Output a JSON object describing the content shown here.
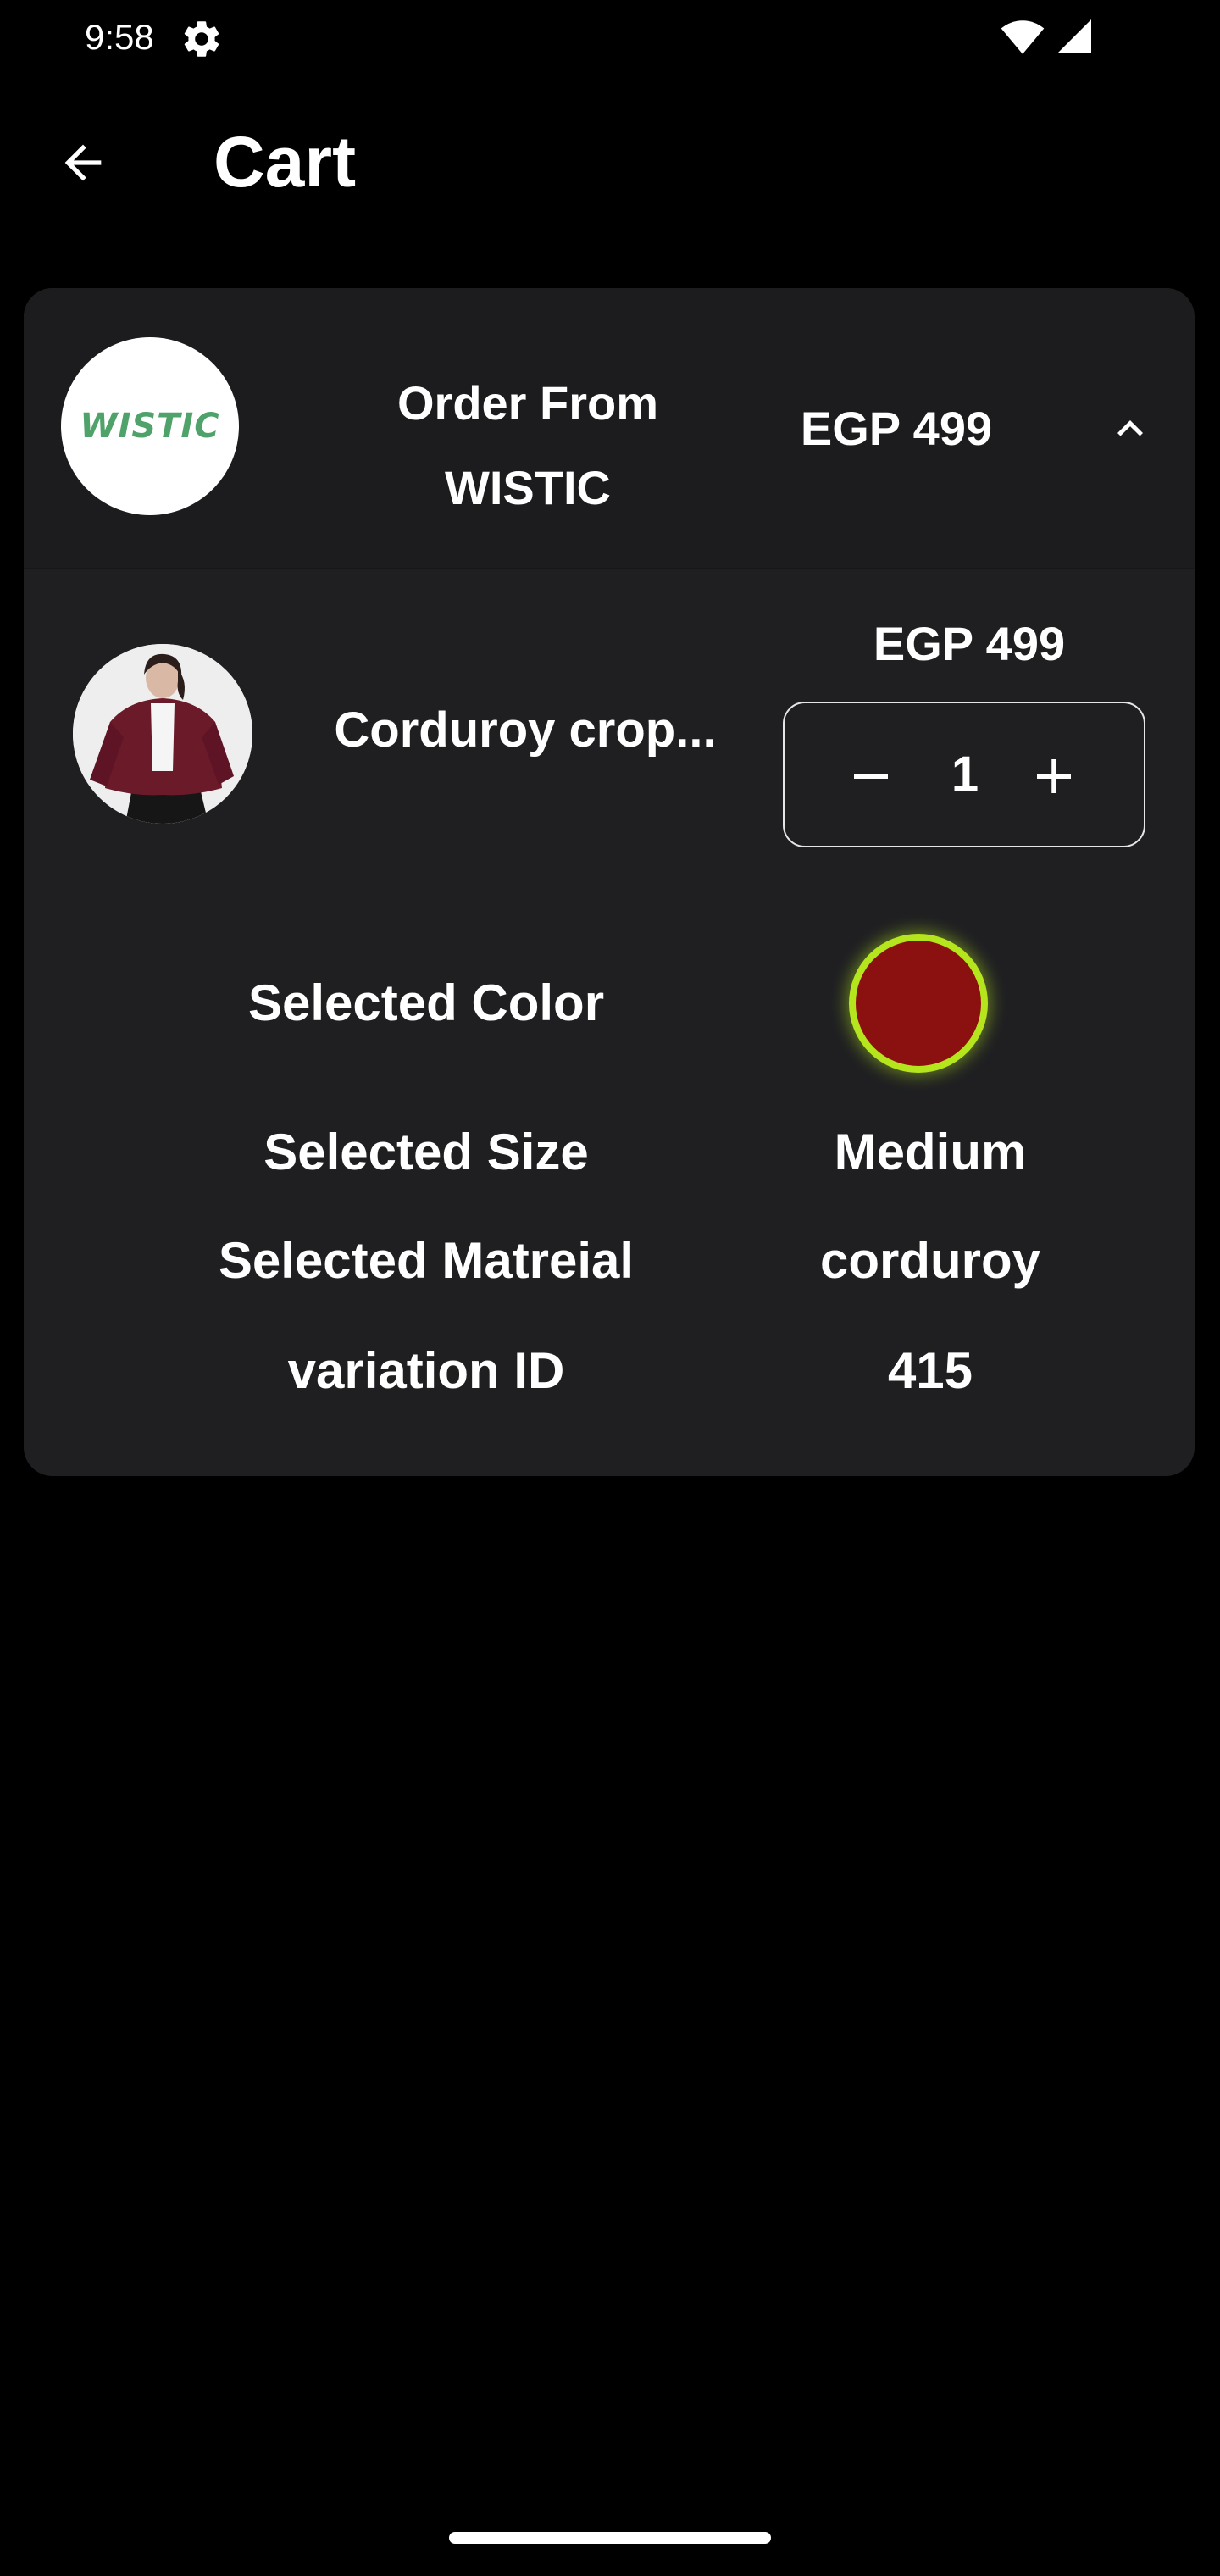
{
  "status_bar": {
    "time": "9:58",
    "icons": [
      "settings-gear-icon",
      "wifi-icon",
      "cellular-signal-icon"
    ]
  },
  "app_bar": {
    "back_icon": "arrow-back-icon",
    "title": "Cart"
  },
  "order": {
    "store_logo_text": "WISTIC",
    "title_line1": "Order From",
    "title_line2": "WISTIC",
    "total": "EGP 499",
    "toggle_icon": "chevron-up-icon",
    "item": {
      "name": "Corduroy crop...",
      "price": "EGP 499",
      "quantity": "1",
      "minus_icon": "minus-icon",
      "plus_icon": "plus-icon"
    },
    "attributes": {
      "color_label": "Selected Color",
      "color_value": "#8b1010",
      "color_ring": "#b5e61d",
      "size_label": "Selected Size",
      "size_value": "Medium",
      "material_label": "Selected Matreial",
      "material_value": "corduroy",
      "variation_label": "variation ID",
      "variation_value": "415"
    }
  },
  "colors": {
    "background": "#000000",
    "card": "#1f1f22",
    "text": "#ffffff",
    "logo_green": "#4fa26a"
  }
}
